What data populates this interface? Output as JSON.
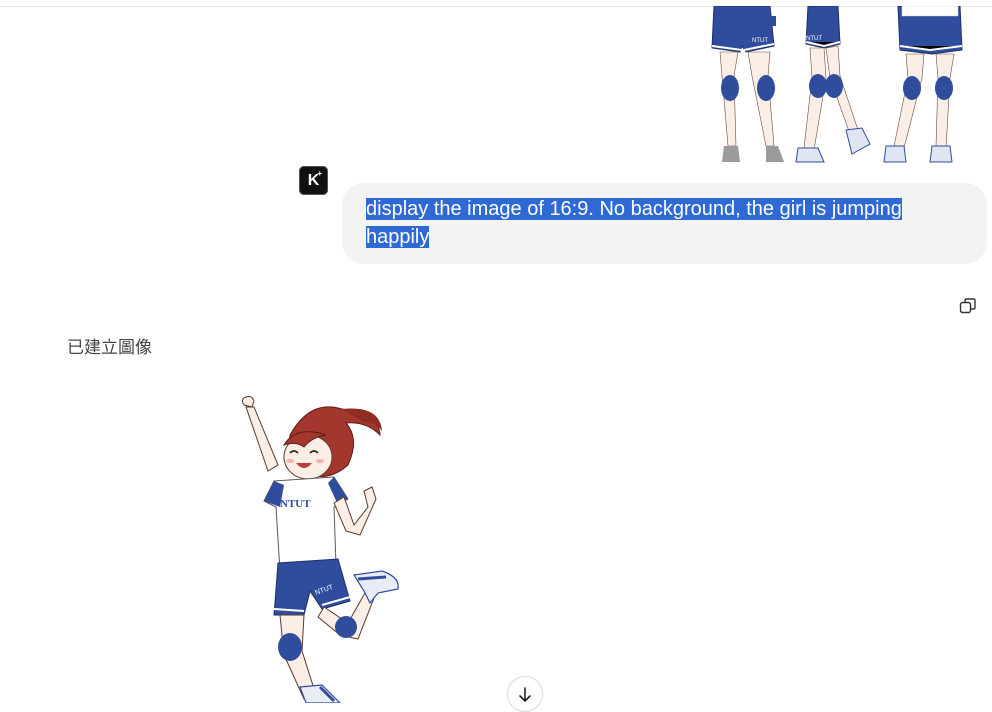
{
  "chat": {
    "user_message": {
      "text_line1": "display the image of 16:9. No background, the girl is jumping",
      "text_line2": "happily"
    },
    "assistant": {
      "status_text": "已建立圖像"
    }
  },
  "badge": {
    "letter": "K"
  },
  "previous_image": {
    "jersey_text": "NTUT"
  },
  "generated_image": {
    "jersey_text": "NTUT"
  },
  "icons": {
    "copy": "copy-icon",
    "scroll_down": "arrow-down-icon"
  },
  "colors": {
    "selection": "#2f6ad4",
    "bubble": "#f3f3f3",
    "jersey_blue": "#2f4d9c",
    "hair": "#a3372d"
  }
}
